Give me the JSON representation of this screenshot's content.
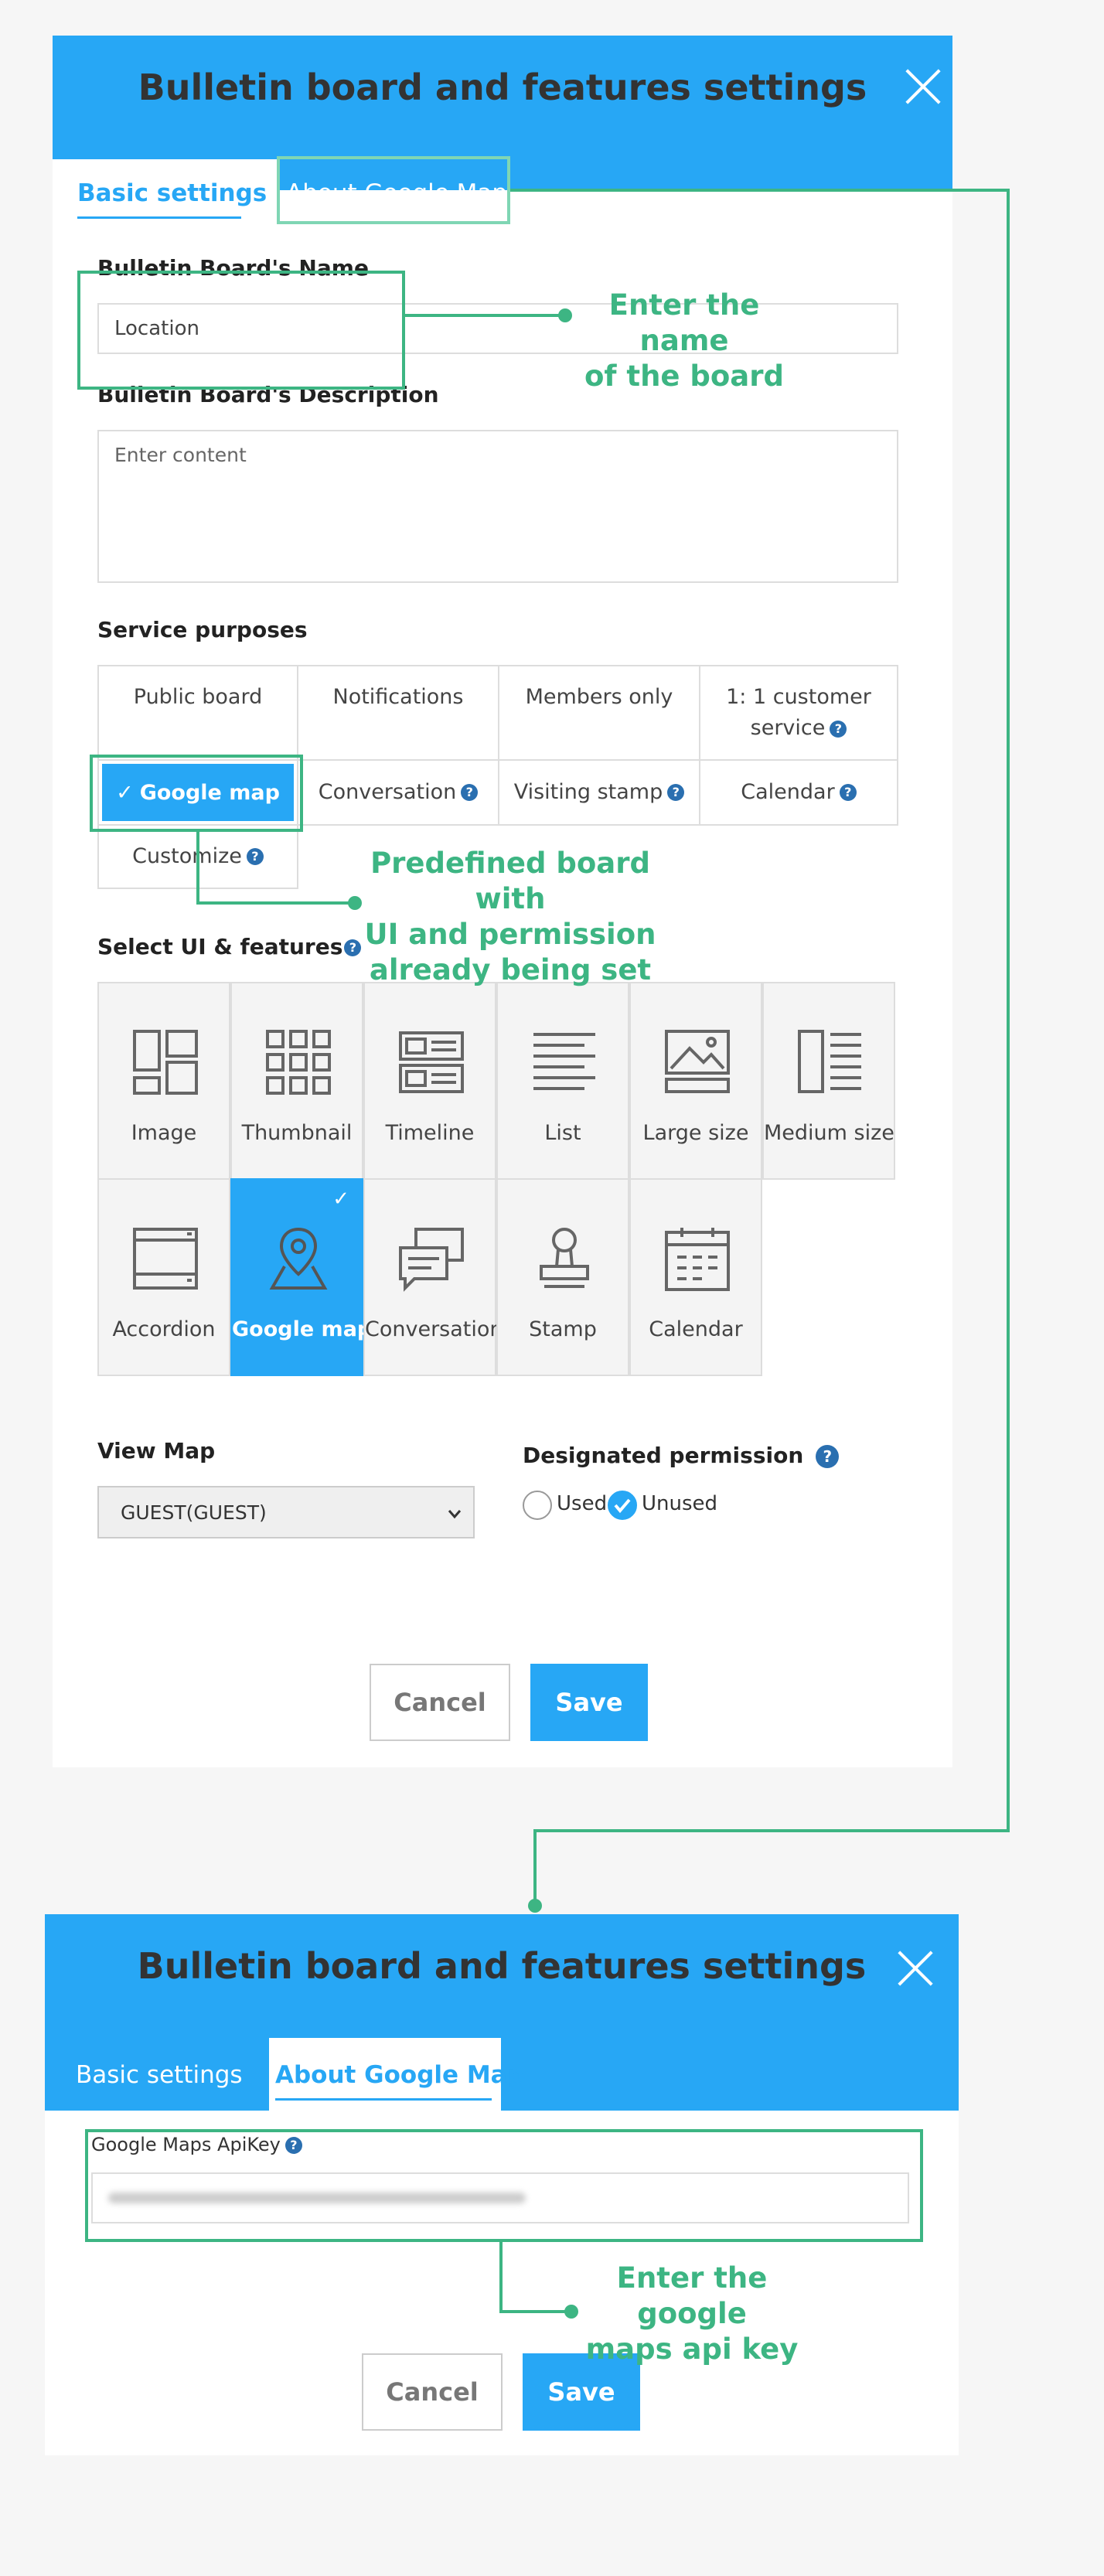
{
  "dialog1": {
    "title": "Bulletin board and features settings",
    "tabs": [
      "Basic settings",
      "About Google Map"
    ],
    "name_label": "Bulletin Board's Name",
    "name_value": "Location",
    "desc_label": "Bulletin Board's Description",
    "desc_placeholder": "Enter content",
    "purposes_label": "Service purposes",
    "purposes": [
      "Public board",
      "Notifications",
      "Members only",
      "1: 1 customer service",
      "Google map",
      "Conversation",
      "Visiting stamp",
      "Calendar",
      "Customize"
    ],
    "selected_purpose": "Google map",
    "ui_label": "Select UI & features",
    "ui_options": [
      "Image",
      "Thumbnail",
      "Timeline",
      "List",
      "Large size",
      "Medium size",
      "Accordion",
      "Google map",
      "Conversation",
      "Stamp",
      "Calendar"
    ],
    "selected_ui": "Google map",
    "view_map_label": "View Map",
    "view_map_value": "GUEST(GUEST)",
    "permission_label": "Designated permission",
    "permission_options": [
      "Used",
      "Unused"
    ],
    "permission_selected": "Unused",
    "cancel": "Cancel",
    "save": "Save"
  },
  "dialog2": {
    "title": "Bulletin board and features settings",
    "tabs": [
      "Basic settings",
      "About Google Map"
    ],
    "apikey_label": "Google Maps ApiKey",
    "cancel": "Cancel",
    "save": "Save"
  },
  "annotations": {
    "name": [
      "Enter the name",
      "of the board"
    ],
    "predefined": [
      "Predefined board with",
      "UI and permission",
      "already being set"
    ],
    "apikey": [
      "Enter the google",
      "maps api key"
    ]
  },
  "colors": {
    "accent": "#27a7f5",
    "annotation": "#3db583"
  }
}
